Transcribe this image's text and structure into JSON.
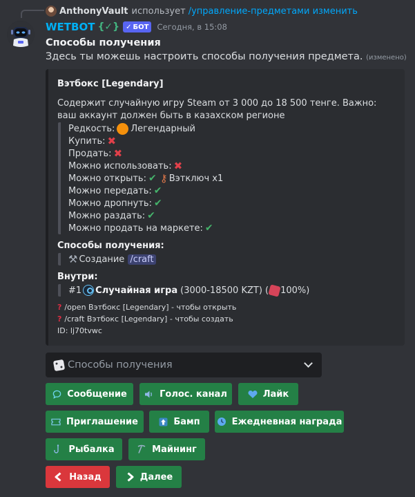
{
  "reply": {
    "username": "AnthonyVault",
    "action": "использует",
    "command": "/управление-предметами изменить"
  },
  "bot": {
    "name": "WETBOT",
    "emblem": "{✓}",
    "tag": "БОТ",
    "timestamp": "Сегодня, в 15:08"
  },
  "message": {
    "title": "Способы получения",
    "text": "Здесь ты можешь настроить способы получения предмета.",
    "edited": "(изменено)"
  },
  "embed": {
    "title": "Вэтбокс [Legendary]",
    "description": "Содержит случайную игру Steam от 3 000 до 18 500 тенге. Важно: ваш аккаунт должен быть в казахском регионе",
    "properties": {
      "rarity_label": "Редкость:",
      "rarity_value": "Легендарный",
      "buy_label": "Купить:",
      "sell_label": "Продать:",
      "use_label": "Можно использовать:",
      "open_label": "Можно открыть:",
      "open_key": "Вэтключ x1",
      "transfer_label": "Можно передать:",
      "drop_label": "Можно дропнуть:",
      "giveaway_label": "Можно раздать:",
      "market_label": "Можно продать на маркете:"
    },
    "obtain": {
      "name": "Способы получения:",
      "method": "Создание",
      "command": "/craft"
    },
    "inside": {
      "name": "Внутри:",
      "prefix": "#1",
      "item": "Случайная игра",
      "range": "(3000-18500 KZT) (",
      "chance": "100%)"
    },
    "footer": {
      "open_hint": "/open Вэтбокс [Legendary] - чтобы открыть",
      "craft_hint": "/craft Вэтбокс [Legendary] - чтобы создать",
      "id": "ID: lj70tvwc"
    }
  },
  "select": {
    "placeholder": "Способы получения"
  },
  "buttons": {
    "message": "Сообщение",
    "voice": "Голос. канал",
    "like": "Лайк",
    "invite": "Приглашение",
    "bump": "Бамп",
    "daily": "Ежедневная награда",
    "fishing": "Рыбалка",
    "mining": "Майнинг",
    "back": "Назад",
    "next": "Далее"
  },
  "icons": {
    "message": "chat-bubble-icon",
    "voice": "speaker-icon",
    "like": "heart-icon",
    "invite": "ticket-icon",
    "bump": "up-arrow-icon",
    "daily": "clock-icon",
    "fishing": "fishing-hook-icon",
    "mining": "pickaxe-icon",
    "back": "arrow-left-icon",
    "next": "arrow-right-icon"
  },
  "colors": {
    "background": "#313338",
    "embed_bg": "#2b2d31",
    "button_green": "#248046",
    "button_red": "#da373c",
    "bot_name": "#00b0f4",
    "bot_tag": "#5865f2"
  }
}
